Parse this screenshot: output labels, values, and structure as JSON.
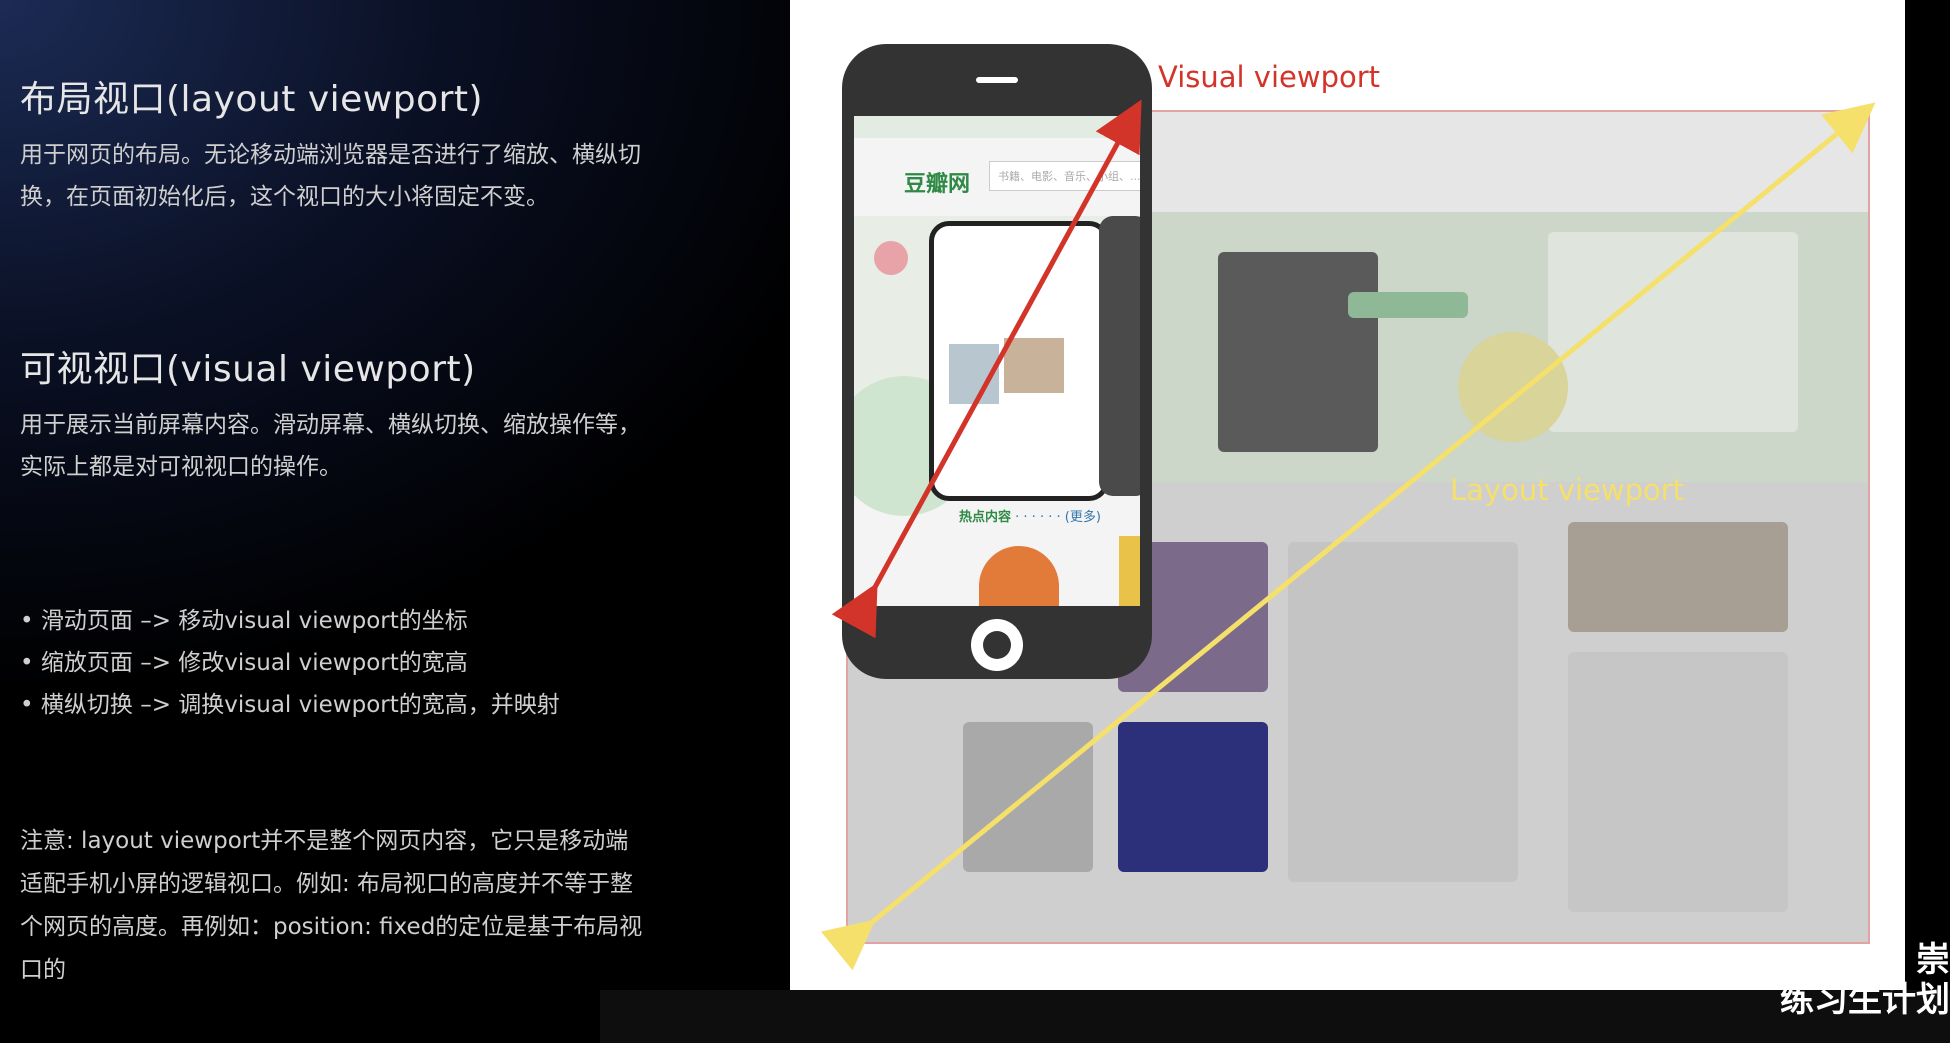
{
  "section1": {
    "heading": "布局视口(layout viewport)",
    "body": "用于网页的布局。无论移动端浏览器是否进行了缩放、横纵切换，在页面初始化后，这个视口的大小将固定不变。"
  },
  "section2": {
    "heading": "可视视口(visual viewport)",
    "body": "用于展示当前屏幕内容。滑动屏幕、横纵切换、缩放操作等，实际上都是对可视视口的操作。"
  },
  "bullets": [
    "• 滑动页面 –> 移动visual viewport的坐标",
    "• 缩放页面 –> 修改visual viewport的宽高",
    "• 横纵切换 –> 调换visual viewport的宽高，并映射"
  ],
  "note": "注意: layout viewport并不是整个网页内容，它只是移动端适配手机小屏的逻辑视口。例如: 布局视口的高度并不等于整个网页的高度。再例如：position: fixed的定位是基于布局视口的",
  "diagram": {
    "visual_label": "Visual viewport",
    "layout_label": "Layout viewport",
    "site_logo": "豆瓣网",
    "search_placeholder": "书籍、电影、音乐、小组、...",
    "hot_label": "热点内容",
    "hot_more": "· · · · · · (更多)",
    "colors": {
      "visual": "#d2342a",
      "layout": "#f4e06a"
    }
  },
  "watermark": [
    "崇",
    "练习生计划"
  ]
}
